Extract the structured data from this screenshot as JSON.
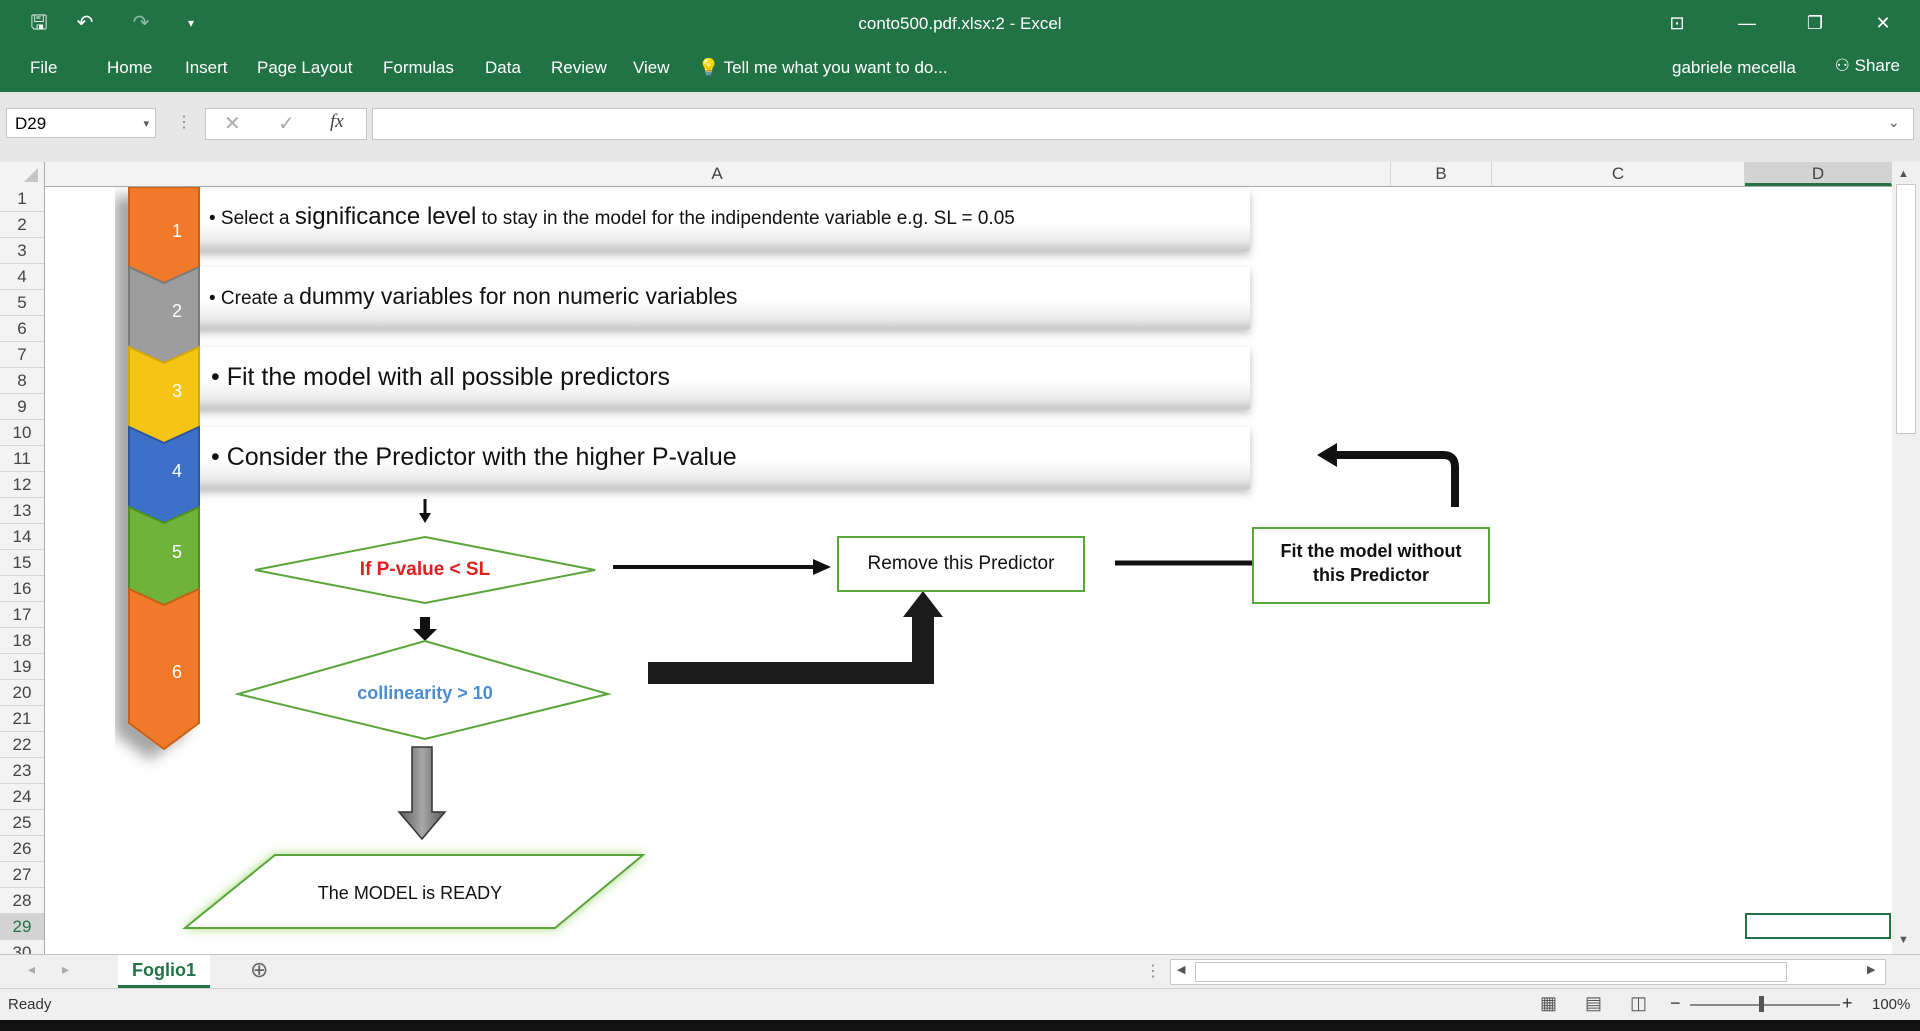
{
  "window": {
    "title": "conto500.pdf.xlsx:2 - Excel",
    "minimize": "—",
    "restore": "❐",
    "close": "✕",
    "ribbon_options": "⊡"
  },
  "ribbon": {
    "tabs": [
      "File",
      "Home",
      "Insert",
      "Page Layout",
      "Formulas",
      "Data",
      "Review",
      "View"
    ],
    "tell_me": "Tell me what you want to do...",
    "user": "gabriele mecella",
    "share": "Share"
  },
  "formula_bar": {
    "namebox": "D29",
    "formula": ""
  },
  "columns": [
    "A",
    "B",
    "C",
    "D"
  ],
  "rows": [
    "1",
    "2",
    "3",
    "4",
    "5",
    "6",
    "7",
    "8",
    "9",
    "10",
    "11",
    "12",
    "13",
    "14",
    "15",
    "16",
    "17",
    "18",
    "19",
    "20",
    "21",
    "22",
    "23",
    "24",
    "25",
    "26",
    "27",
    "28",
    "29",
    "30"
  ],
  "steps": [
    {
      "num": "1",
      "color": "#f07a2b",
      "text_pre": "• Select a ",
      "text_big1": "significance  level",
      "text_post": " to stay in the model for the indipendente variable e.g. SL  = 0.05"
    },
    {
      "num": "2",
      "color": "#9a9a9a",
      "text_pre": "• Create a ",
      "text_big1": "dummy variables",
      "text_post": "  for non numeric variables"
    },
    {
      "num": "3",
      "color": "#f5c518",
      "text": "• Fit the model with all possible predictors"
    },
    {
      "num": "4",
      "color": "#3d6fc9",
      "text": "• Consider the Predictor with the higher P-value"
    },
    {
      "num": "5",
      "color": "#6fb33a"
    },
    {
      "num": "6",
      "color": "#f07a2b"
    }
  ],
  "flow": {
    "pvalue": "If P-value < SL",
    "collinearity": "collinearity > 10",
    "remove": "Remove  this Predictor",
    "fit_without": "Fit the model without this Predictor",
    "ready": "The MODEL is READY"
  },
  "sheet": {
    "tab": "Foglio1",
    "add": "⊕"
  },
  "status": {
    "ready": "Ready",
    "zoom": "100%",
    "zoom_minus": "−",
    "zoom_plus": "+"
  }
}
